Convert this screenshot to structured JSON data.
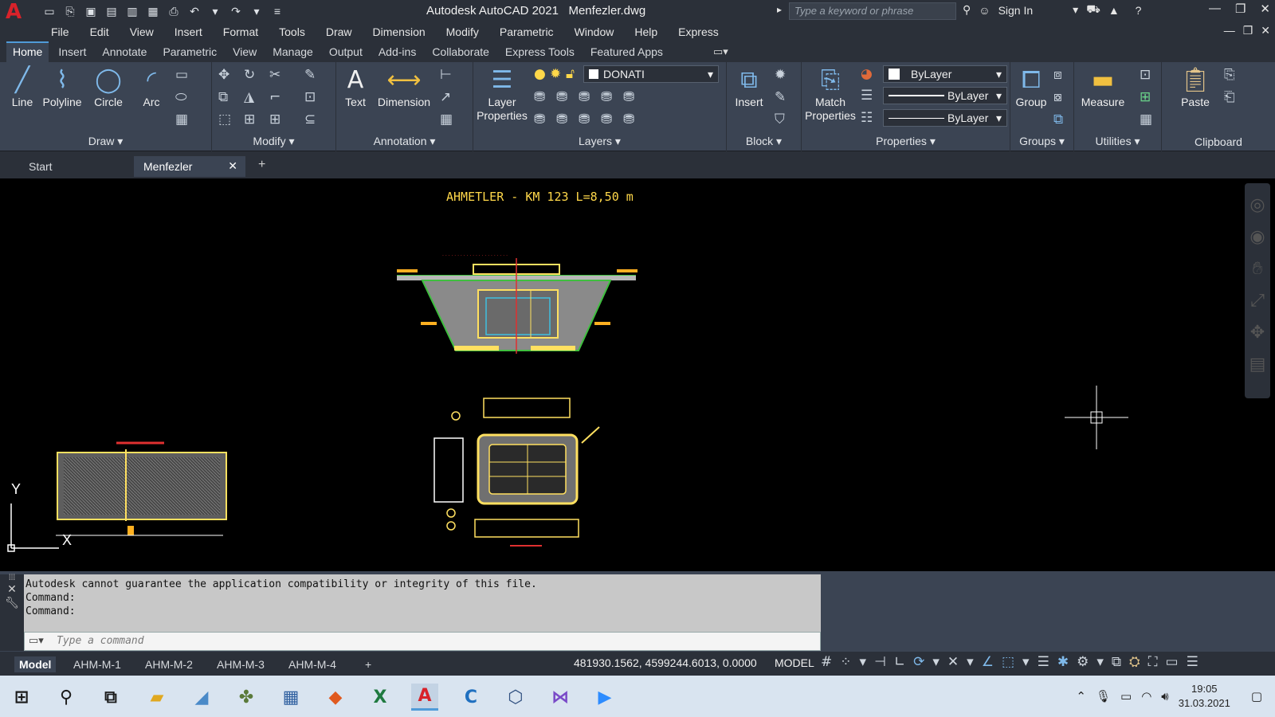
{
  "titlebar": {
    "app_logo": "A",
    "title": "Autodesk AutoCAD 2021",
    "filename": "Menfezler.dwg",
    "search_placeholder": "Type a keyword or phrase",
    "sign_in": "Sign In"
  },
  "menus": [
    "File",
    "Edit",
    "View",
    "Insert",
    "Format",
    "Tools",
    "Draw",
    "Dimension",
    "Modify",
    "Parametric",
    "Window",
    "Help",
    "Express"
  ],
  "ribbon_tabs": [
    "Home",
    "Insert",
    "Annotate",
    "Parametric",
    "View",
    "Manage",
    "Output",
    "Add-ins",
    "Collaborate",
    "Express Tools",
    "Featured Apps"
  ],
  "ribbon": {
    "draw": {
      "label": "Draw",
      "line": "Line",
      "polyline": "Polyline",
      "circle": "Circle",
      "arc": "Arc"
    },
    "modify": {
      "label": "Modify"
    },
    "annotation": {
      "label": "Annotation",
      "text": "Text",
      "dimension": "Dimension"
    },
    "layers": {
      "label": "Layers",
      "layer_properties_1": "Layer",
      "layer_properties_2": "Properties",
      "current_layer": "DONATI"
    },
    "block": {
      "label": "Block",
      "insert": "Insert"
    },
    "properties": {
      "label": "Properties",
      "match_1": "Match",
      "match_2": "Properties",
      "color": "ByLayer",
      "lineweight": "ByLayer",
      "linetype": "ByLayer"
    },
    "groups": {
      "label": "Groups",
      "group": "Group"
    },
    "utilities": {
      "label": "Utilities",
      "measure": "Measure"
    },
    "clipboard": {
      "label": "Clipboard",
      "paste": "Paste"
    }
  },
  "doc_tabs": {
    "start": "Start",
    "current": "Menfezler"
  },
  "drawing": {
    "title": "AHMETLER - KM 123 L=8,50 m",
    "ucs_y": "Y",
    "ucs_x": "X"
  },
  "command": {
    "lines": [
      "Autodesk cannot guarantee the application compatibility or integrity of this file.",
      "Command:",
      "Command:"
    ],
    "placeholder": "Type a command"
  },
  "layout_tabs": [
    "Model",
    "AHM-M-1",
    "AHM-M-2",
    "AHM-M-3",
    "AHM-M-4"
  ],
  "status": {
    "coordinates": "481930.1562, 4599244.6013, 0.0000",
    "mode": "MODEL"
  },
  "taskbar": {
    "time": "19:05",
    "date": "31.03.2021"
  },
  "colors": {
    "accent": "#4f9bd8",
    "drawing_yellow": "#ffd84a",
    "autocad_red": "#d8222a"
  }
}
